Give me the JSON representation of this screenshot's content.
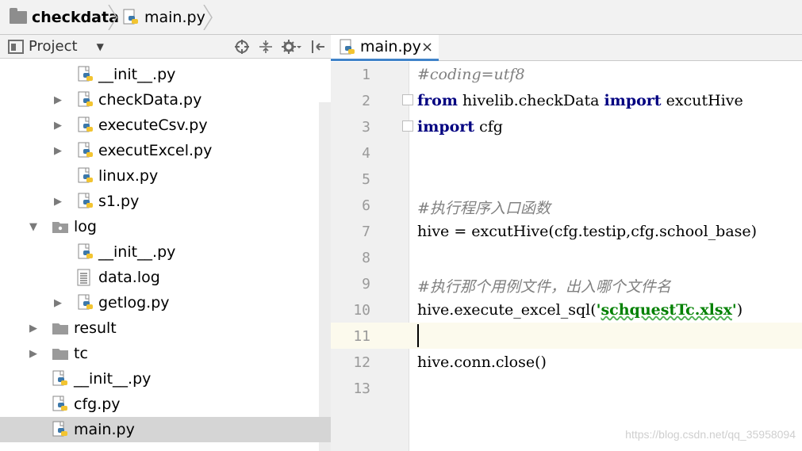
{
  "breadcrumb": {
    "project": "checkdata",
    "file": "main.py"
  },
  "project_panel": {
    "title": "Project",
    "tree": [
      {
        "label": "__init__.py",
        "type": "python",
        "arrow": ""
      },
      {
        "label": "checkData.py",
        "type": "python",
        "arrow": "▶"
      },
      {
        "label": "executeCsv.py",
        "type": "python",
        "arrow": "▶"
      },
      {
        "label": "executExcel.py",
        "type": "python",
        "arrow": "▶"
      },
      {
        "label": "linux.py",
        "type": "python",
        "arrow": ""
      },
      {
        "label": "s1.py",
        "type": "python",
        "arrow": "▶"
      },
      {
        "label": "log",
        "type": "package",
        "arrow": "▼"
      },
      {
        "label": "__init__.py",
        "type": "python",
        "arrow": ""
      },
      {
        "label": "data.log",
        "type": "log",
        "arrow": ""
      },
      {
        "label": "getlog.py",
        "type": "python",
        "arrow": "▶"
      },
      {
        "label": "result",
        "type": "folder",
        "arrow": "▶"
      },
      {
        "label": "tc",
        "type": "folder",
        "arrow": "▶"
      },
      {
        "label": "__init__.py",
        "type": "python",
        "arrow": ""
      },
      {
        "label": "cfg.py",
        "type": "python",
        "arrow": ""
      },
      {
        "label": "main.py",
        "type": "python",
        "arrow": "",
        "selected": true
      }
    ]
  },
  "editor": {
    "tab": {
      "label": "main.py",
      "close": "×"
    },
    "line_numbers": [
      "1",
      "2",
      "3",
      "4",
      "5",
      "6",
      "7",
      "8",
      "9",
      "10",
      "11",
      "12",
      "13"
    ],
    "lines": {
      "l1": "#coding=utf8",
      "l2_kw1": "from",
      "l2_mod": " hivelib.checkData ",
      "l2_kw2": "import",
      "l2_name": " excutHive",
      "l3_kw": "import",
      "l3_name": " cfg",
      "l6": "#执行程序入口函数",
      "l7": "hive = excutHive(cfg.testip,cfg.school_base)",
      "l9": "#执行那个用例文件，出入哪个文件名",
      "l10_pre": "hive.execute_excel_sql(",
      "l10_q1": "'",
      "l10_str": "schquestTc.xlsx",
      "l10_q2": "'",
      "l10_post": ")",
      "l12": "hive.conn.close()"
    }
  },
  "watermark": "https://blog.csdn.net/qq_35958094",
  "colors": {
    "keyword": "#000080",
    "comment": "#808080",
    "string": "#008000",
    "selection": "#d5d5d5",
    "current_line": "#fcfaed"
  }
}
